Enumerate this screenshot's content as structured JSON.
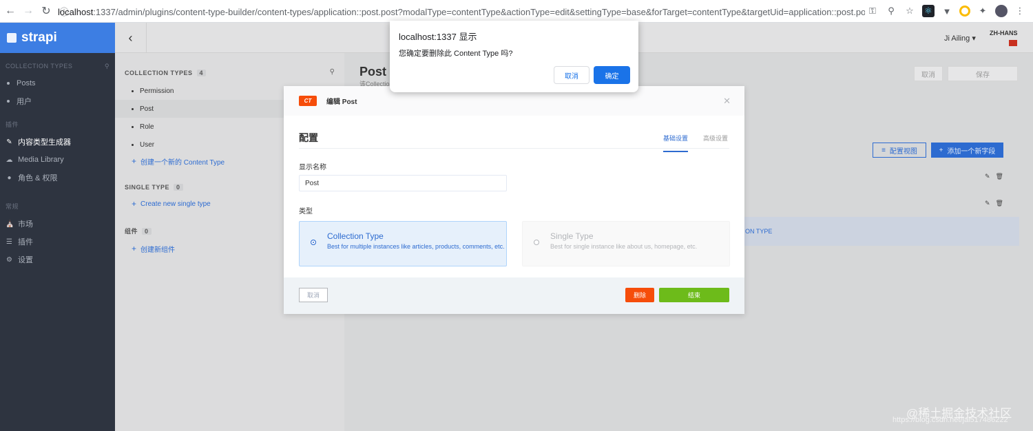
{
  "browser": {
    "url_host": "localhost",
    "url_rest": ":1337/admin/plugins/content-type-builder/content-types/application::post.post?modalType=contentType&actionType=edit&settingType=base&forTarget=contentType&targetUid=application::post.post&he..."
  },
  "sidebar": {
    "logo": "strapi",
    "collection_header": "COLLECTION TYPES",
    "collections": [
      "Posts",
      "用户"
    ],
    "plugins_header": "插件",
    "plugins": [
      {
        "label": "内容类型生成器",
        "icon": "brush-icon"
      },
      {
        "label": "Media Library",
        "icon": "cloud-icon"
      },
      {
        "label": "角色 & 权限",
        "icon": "users-icon"
      }
    ],
    "general_header": "常规",
    "general": [
      {
        "label": "市场",
        "icon": "shop-icon"
      },
      {
        "label": "插件",
        "icon": "list-icon"
      },
      {
        "label": "设置",
        "icon": "gear-icon"
      }
    ]
  },
  "topbar": {
    "user": "Ji Ailing",
    "lang": "ZH-HANS"
  },
  "ctb": {
    "collection_header": "COLLECTION TYPES",
    "collection_count": "4",
    "collection_items": [
      "Permission",
      "Post",
      "Role",
      "User"
    ],
    "add_collection": "创建一个新的 Content Type",
    "single_header": "SINGLE TYPE",
    "single_count": "0",
    "add_single": "Create new single type",
    "components_header": "组件",
    "components_count": "0",
    "add_component": "创建新组件"
  },
  "post_area": {
    "title": "Post",
    "subtitle": "该Collection",
    "cancel": "取消",
    "save": "保存",
    "configure_view": "配置视图",
    "add_field": "添加一个新字段",
    "strip_text": "ON TYPE"
  },
  "modal": {
    "badge": "CT",
    "title": "编辑 Post",
    "section_title": "配置",
    "tab_basic": "基础设置",
    "tab_advanced": "高级设置",
    "display_name_label": "显示名称",
    "display_name_value": "Post",
    "type_label": "类型",
    "collection_title": "Collection Type",
    "collection_desc": "Best for multiple instances like articles, products, comments, etc.",
    "single_title": "Single Type",
    "single_desc": "Best for single instance like about us, homepage, etc.",
    "cancel": "取消",
    "delete": "删除",
    "finish": "结束"
  },
  "confirm": {
    "title": "localhost:1337 显示",
    "message": "您确定要删除此 Content Type 吗?",
    "cancel": "取消",
    "ok": "确定"
  },
  "watermark": {
    "text": "@稀土掘金技术社区",
    "url": "https://blog.csdn.net/jal517486222"
  }
}
